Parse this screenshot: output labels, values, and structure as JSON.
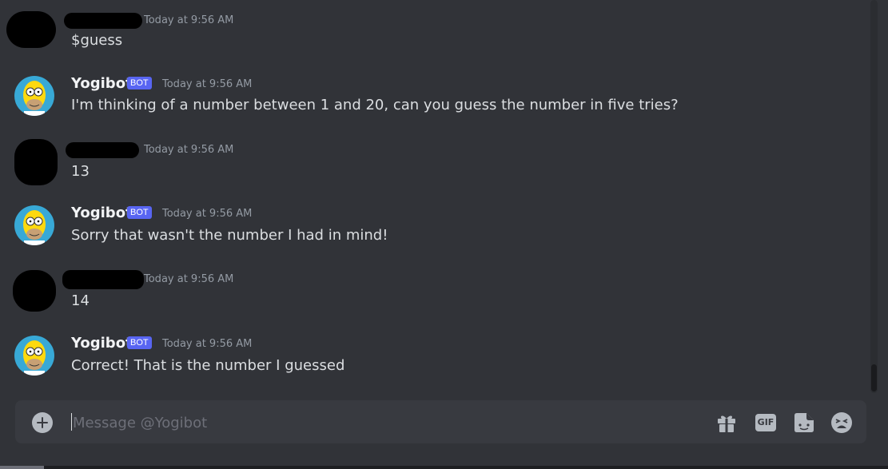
{
  "messages": [
    {
      "author": "",
      "redacted": true,
      "timestamp": "Today at 9:56 AM",
      "text": "$guess"
    },
    {
      "author": "Yogibot",
      "bot": true,
      "badge": "BOT",
      "timestamp": "Today at 9:56 AM",
      "text": "I'm thinking of a number between 1 and 20, can you guess the number in five tries?"
    },
    {
      "author": "",
      "redacted": true,
      "timestamp": "Today at 9:56 AM",
      "text": "13"
    },
    {
      "author": "Yogibot",
      "bot": true,
      "badge": "BOT",
      "timestamp": "Today at 9:56 AM",
      "text": "Sorry that wasn't the number I had in mind!"
    },
    {
      "author": "",
      "redacted": true,
      "timestamp": "Today at 9:56 AM",
      "text": "14"
    },
    {
      "author": "Yogibot",
      "bot": true,
      "badge": "BOT",
      "timestamp": "Today at 9:56 AM",
      "text": "Correct! That is the number I guessed"
    }
  ],
  "composer": {
    "placeholder": "Message @Yogibot",
    "value": "",
    "gif_label": "GIF"
  },
  "icons": {
    "add": "plus-circle-icon",
    "gift": "gift-icon",
    "gif": "gif-icon",
    "sticker": "sticker-icon",
    "emoji": "emoji-icon"
  },
  "colors": {
    "background": "#313338",
    "composer": "#383a40",
    "bot_badge": "#5865f2",
    "username": "#f2f3f5",
    "timestamp": "#949ba4"
  }
}
